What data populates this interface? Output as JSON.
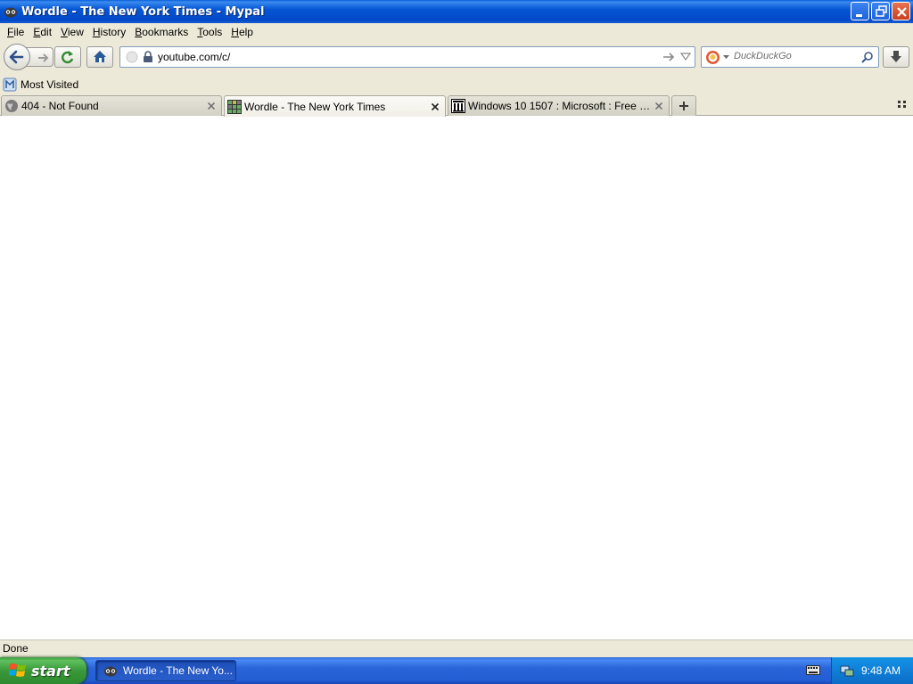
{
  "window": {
    "title": "Wordle - The New York Times - Mypal"
  },
  "menu": {
    "items": [
      "File",
      "Edit",
      "View",
      "History",
      "Bookmarks",
      "Tools",
      "Help"
    ]
  },
  "navbar": {
    "url": "youtube.com/c/",
    "search_placeholder": "DuckDuckGo"
  },
  "bookmarks": {
    "items": [
      {
        "label": "Most Visited",
        "icon": "bookmark-folder-icon"
      }
    ]
  },
  "tabs": [
    {
      "title": "404 - Not Found",
      "icon": "globe-icon",
      "active": false
    },
    {
      "title": "Wordle - The New York Times",
      "icon": "wordle-grid-icon",
      "active": true
    },
    {
      "title": "Windows 10 1507 : Microsoft : Free Dow...",
      "icon": "archive-icon",
      "active": false
    }
  ],
  "status": {
    "text": "Done"
  },
  "taskbar": {
    "start_label": "start",
    "task_label": "Wordle - The New Yo...",
    "clock": "9:48 AM"
  },
  "colors": {
    "titlebar": "#0655d4",
    "taskbar": "#245ed4",
    "start": "#3a993a",
    "tray": "#0f7fd8"
  }
}
